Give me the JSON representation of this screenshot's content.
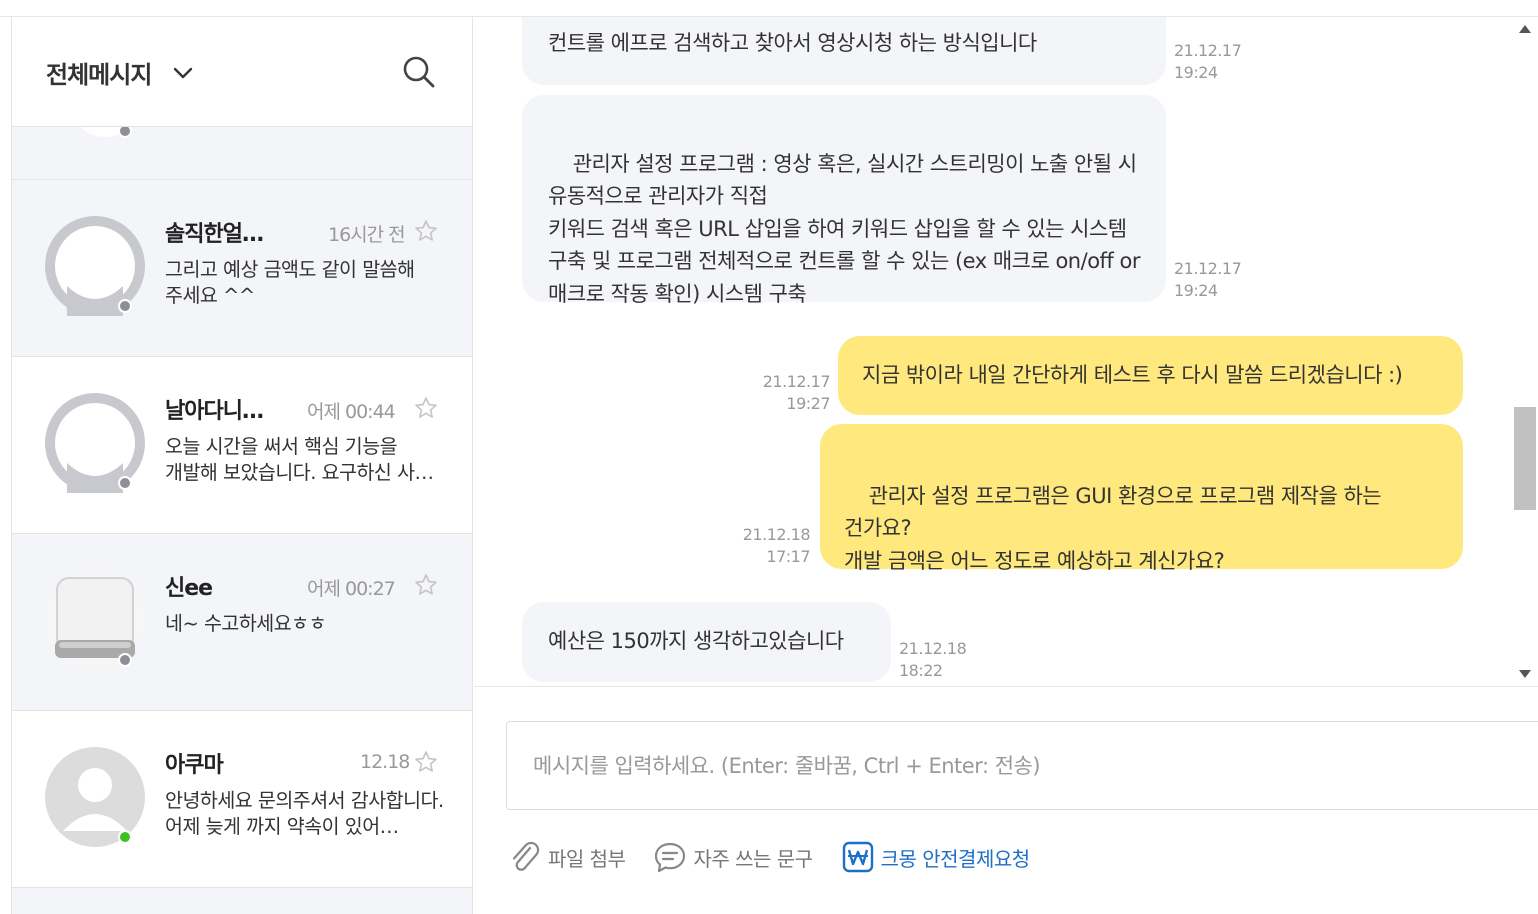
{
  "sidebar": {
    "filter_label": "전체메시지",
    "conversations": [
      {
        "name": "솔직한얼…",
        "time": "16시간 전",
        "preview": "그리고 예상 금액도 같이 말씀해 주세요 ^^",
        "status": "offline"
      },
      {
        "name": "날아다니…",
        "time": "어제 00:44",
        "preview": "오늘 시간을 써서 핵심 기능을 개발해 보았습니다. 요구하신 사…",
        "status": "offline"
      },
      {
        "name": "신ee",
        "time": "어제 00:27",
        "preview": "네~ 수고하세요ㅎㅎ",
        "status": "offline"
      },
      {
        "name": "아쿠마",
        "time": "12.18",
        "preview": "안녕하세요 문의주셔서 감사합니다. 어제 늦게 까지 약속이 있어…",
        "status": "online"
      }
    ]
  },
  "chat": {
    "messages": [
      {
        "dir": "in",
        "text": "컨트롤 에프로 검색하고 찾아서 영상시청 하는 방식입니다",
        "date": "21.12.17",
        "time": "19:24"
      },
      {
        "dir": "in",
        "text": "관리자 설정 프로그램 : 영상 혹은, 실시간 스트리밍이 노출 안될 시 유동적으로 관리자가 직접\n키워드 검색 혹은 URL 삽입을 하여 키워드 삽입을 할 수 있는 시스템 구축 및 프로그램 전체적으로 컨트롤 할 수 있는 (ex 매크로 on/off or 매크로 작동 확인) 시스템 구축",
        "date": "21.12.17",
        "time": "19:24"
      },
      {
        "dir": "out",
        "text": "지금 밖이라 내일 간단하게 테스트 후 다시 말씀 드리겠습니다 :)",
        "date": "21.12.17",
        "time": "19:27"
      },
      {
        "dir": "out",
        "text": "관리자 설정 프로그램은 GUI 환경으로 프로그램 제작을 하는 건가요?\n개발 금액은 어느 정도로 예상하고 계신가요?",
        "date": "21.12.18",
        "time": "17:17"
      },
      {
        "dir": "in",
        "text": "예산은 150까지 생각하고있습니다",
        "date": "21.12.18",
        "time": "18:22"
      }
    ]
  },
  "composer": {
    "placeholder": "메시지를 입력하세요. (Enter: 줄바꿈, Ctrl + Enter: 전송)",
    "attach_label": "파일 첨부",
    "phrases_label": "자주 쓰는 문구",
    "pay_label": "크몽 안전결제요청"
  },
  "colors": {
    "outgoing_bubble": "#ffe97f",
    "incoming_bubble": "#f4f5f9",
    "online_dot": "#3cc11e",
    "offline_dot": "#8e8e96",
    "pay_link": "#1f6fc9"
  }
}
